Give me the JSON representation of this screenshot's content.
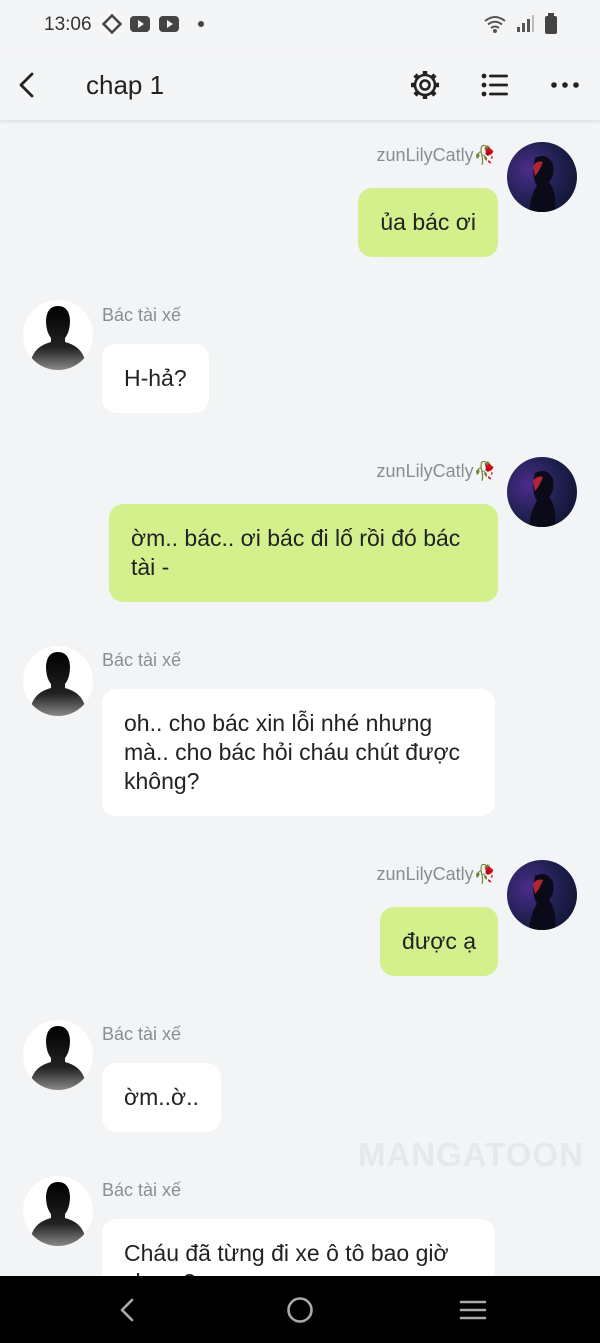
{
  "status_bar": {
    "time": "13:06",
    "left_icons": [
      "diamond-icon",
      "youtube-icon",
      "youtube-icon",
      "dot-icon"
    ],
    "right_icons": [
      "wifi-icon",
      "signal-icon",
      "battery-icon"
    ]
  },
  "app_bar": {
    "title": "chap 1",
    "actions": [
      "settings-icon",
      "list-icon",
      "more-icon"
    ]
  },
  "chat": {
    "messages": [
      {
        "side": "right",
        "sender": "zunLilyCatly🥀",
        "text": "ủa bác ơi"
      },
      {
        "side": "left",
        "sender": "Bác tài xế",
        "text": "H-hả?"
      },
      {
        "side": "right",
        "sender": "zunLilyCatly🥀",
        "text": "ờm.. bác.. ơi bác đi lố rồi đó bác tài -"
      },
      {
        "side": "left",
        "sender": "Bác tài xế",
        "text": "oh.. cho bác xin lỗi nhé nhưng mà.. cho bác hỏi cháu chút được không?"
      },
      {
        "side": "right",
        "sender": "zunLilyCatly🥀",
        "text": "được ạ"
      },
      {
        "side": "left",
        "sender": "Bác tài xế",
        "text": "ờm..ờ.."
      },
      {
        "side": "left",
        "sender": "Bác tài xế",
        "text": "Cháu đã từng đi xe ô tô bao giờ chưa ?"
      }
    ]
  },
  "watermark": "MANGATOON",
  "colors": {
    "my_bubble": "#d4f08c",
    "other_bubble": "#ffffff",
    "background": "#f2f4f6",
    "nav_bar": "#000000"
  },
  "nav_bar": {
    "buttons": [
      "nav-back-icon",
      "nav-home-icon",
      "nav-menu-icon"
    ]
  }
}
